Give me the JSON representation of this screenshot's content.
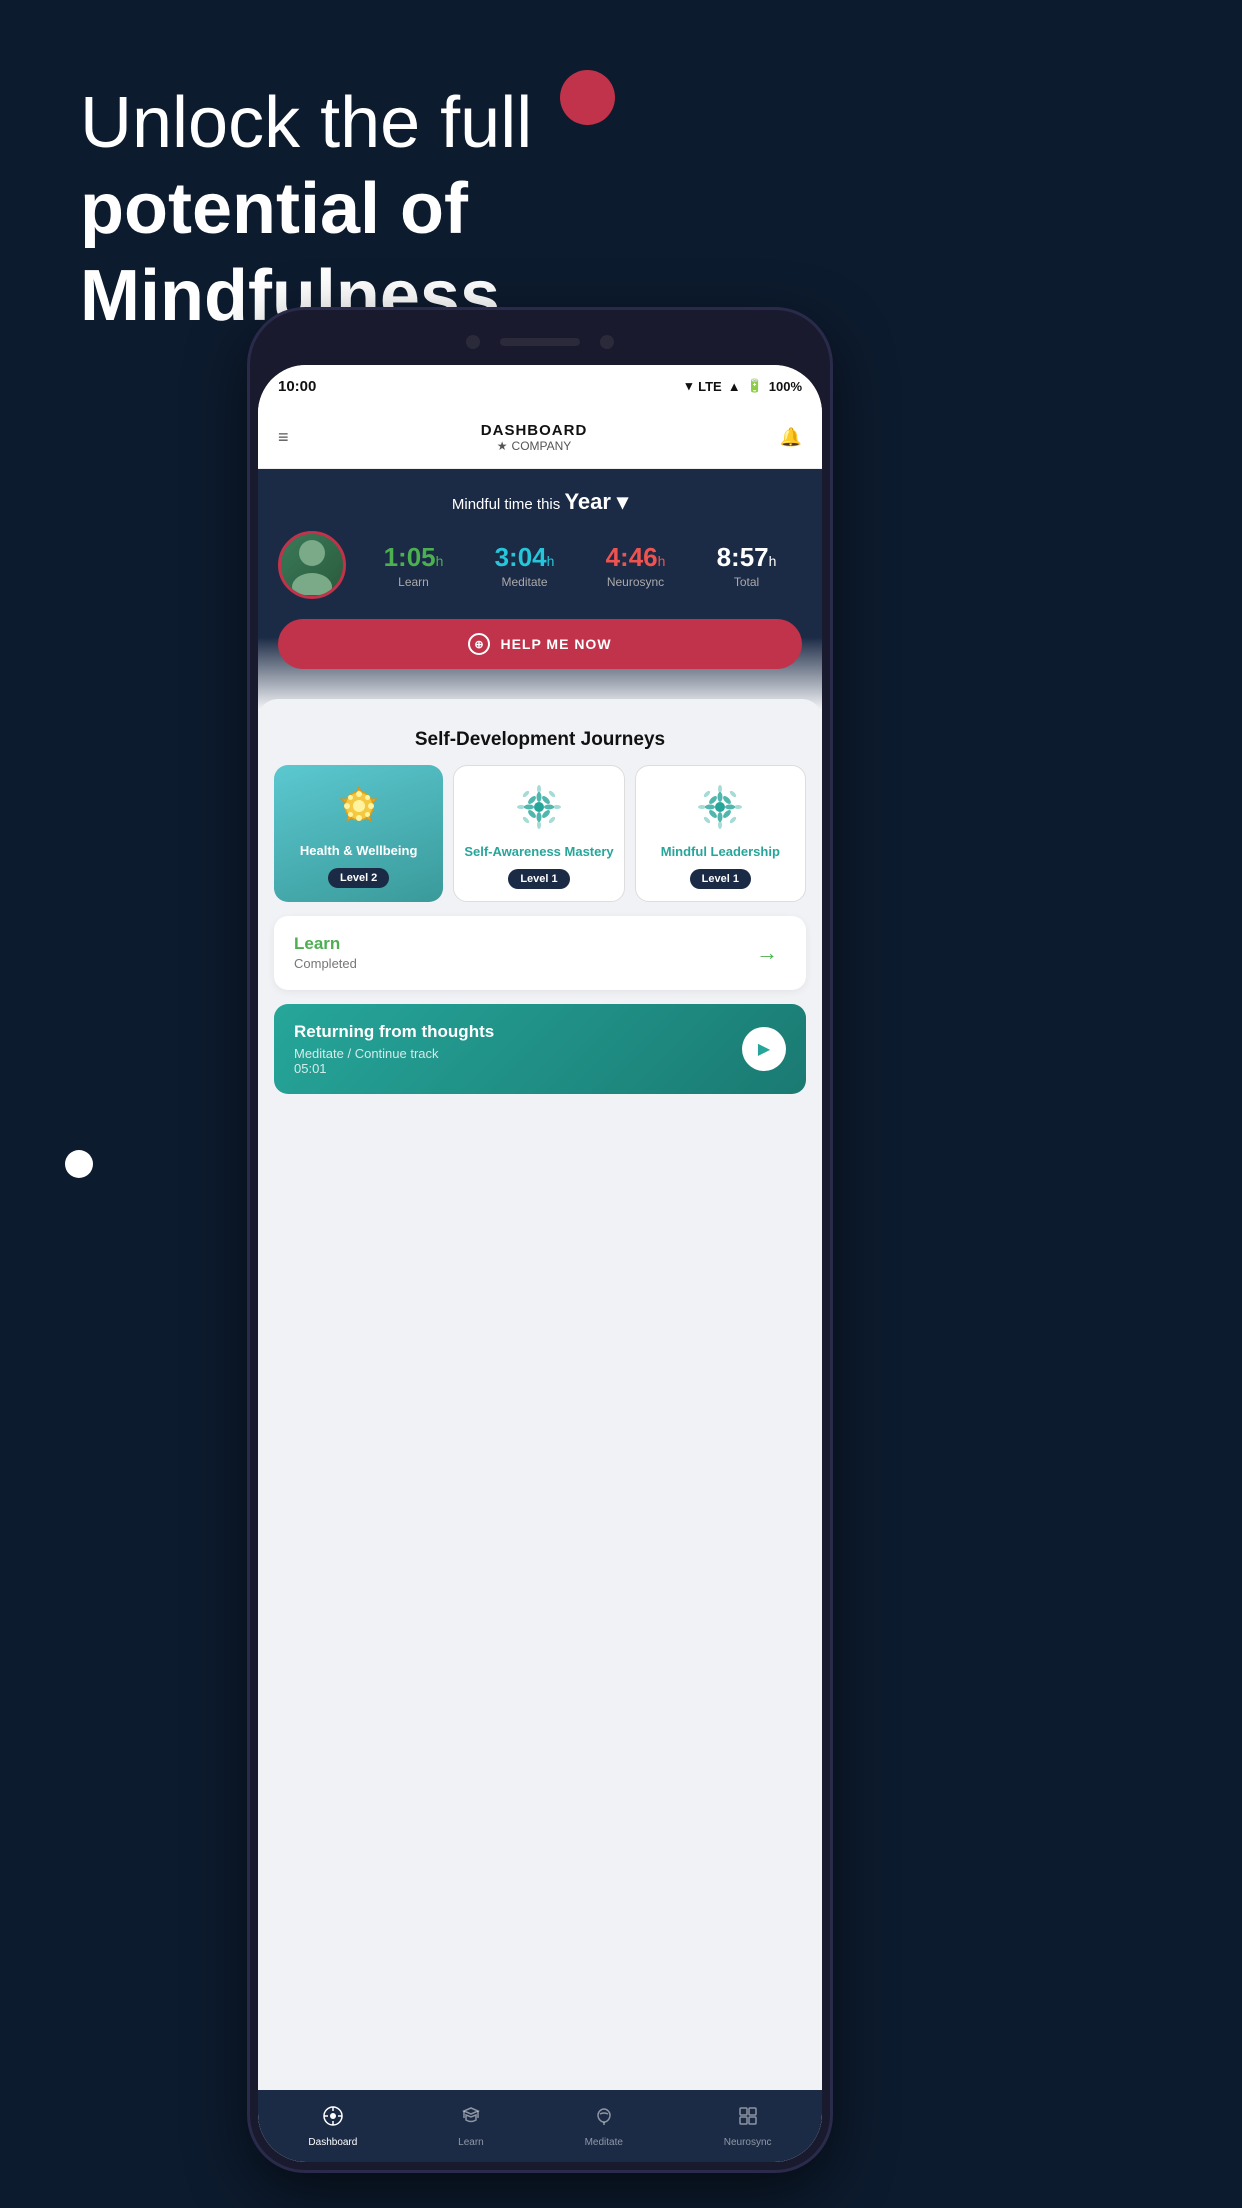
{
  "background": {
    "headline_part1": "Unlock the full",
    "headline_part2": "potential of ",
    "headline_bold": "Mindfulness."
  },
  "status_bar": {
    "time": "10:00",
    "lte": "LTE",
    "battery": "100%"
  },
  "header": {
    "title": "DASHBOARD",
    "subtitle": "COMPANY"
  },
  "dashboard": {
    "time_label": "Mindful time this",
    "period": "Year",
    "stats": [
      {
        "value": "1:05",
        "unit": "h",
        "label": "Learn",
        "color": "learn"
      },
      {
        "value": "3:04",
        "unit": "h",
        "label": "Meditate",
        "color": "meditate"
      },
      {
        "value": "4:46",
        "unit": "h",
        "label": "Neurosync",
        "color": "neuro"
      },
      {
        "value": "8:57",
        "unit": "h",
        "label": "Total",
        "color": "total"
      }
    ],
    "help_button": "HELP ME NOW"
  },
  "journeys": {
    "section_title": "Self-Development Journeys",
    "cards": [
      {
        "title": "Health & Wellbeing",
        "level": "Level 2",
        "featured": true,
        "icon_type": "medal"
      },
      {
        "title": "Self-Awareness Mastery",
        "level": "Level 1",
        "featured": false,
        "icon_type": "mandala"
      },
      {
        "title": "Mindful Leadership",
        "level": "Level 1",
        "featured": false,
        "icon_type": "mandala"
      }
    ]
  },
  "learn_card": {
    "title": "Learn",
    "subtitle": "Completed",
    "arrow": "→"
  },
  "meditate_card": {
    "title": "Returning from thoughts",
    "subtitle": "Meditate / Continue track",
    "duration": "05:01"
  },
  "bottom_nav": {
    "items": [
      {
        "label": "Dashboard",
        "active": true,
        "icon": "dashboard"
      },
      {
        "label": "Learn",
        "active": false,
        "icon": "learn"
      },
      {
        "label": "Meditate",
        "active": false,
        "icon": "meditate"
      },
      {
        "label": "Neurosync",
        "active": false,
        "icon": "neurosync"
      }
    ]
  }
}
